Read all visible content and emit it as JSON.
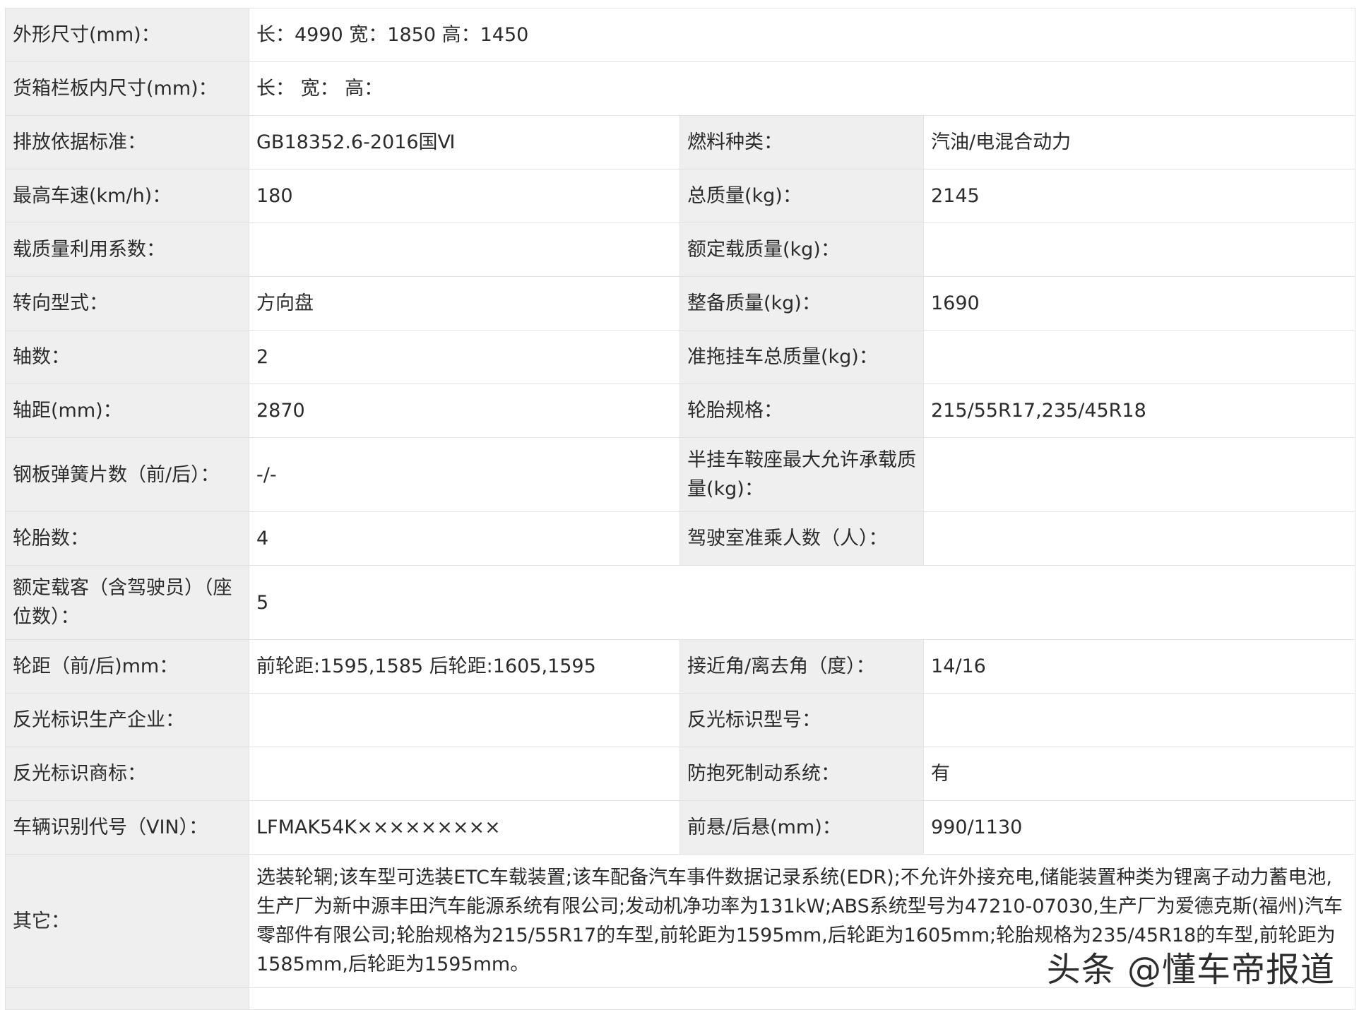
{
  "rows": [
    {
      "l1": "外形尺寸(mm)：",
      "v1": "长：4990 宽：1850 高：1450"
    },
    {
      "l1": "货箱栏板内尺寸(mm)：",
      "v1": "长：  宽：  高："
    },
    {
      "l1": "排放依据标准：",
      "v1": "GB18352.6-2016国Ⅵ",
      "l2": "燃料种类：",
      "v2": "汽油/电混合动力"
    },
    {
      "l1": "最高车速(km/h)：",
      "v1": "180",
      "l2": "总质量(kg)：",
      "v2": "2145"
    },
    {
      "l1": "载质量利用系数：",
      "v1": "",
      "l2": "额定载质量(kg)：",
      "v2": ""
    },
    {
      "l1": "转向型式：",
      "v1": "方向盘",
      "l2": "整备质量(kg)：",
      "v2": "1690"
    },
    {
      "l1": "轴数：",
      "v1": "2",
      "l2": "准拖挂车总质量(kg)：",
      "v2": ""
    },
    {
      "l1": "轴距(mm)：",
      "v1": "2870",
      "l2": "轮胎规格：",
      "v2": "215/55R17,235/45R18"
    },
    {
      "l1": "钢板弹簧片数（前/后）：",
      "v1": "-/-",
      "l2": "半挂车鞍座最大允许承载质量(kg)：",
      "v2": ""
    },
    {
      "l1": "轮胎数：",
      "v1": "4",
      "l2": "驾驶室准乘人数（人）：",
      "v2": ""
    },
    {
      "l1": "额定载客（含驾驶员）（座位数）：",
      "v1": "5"
    },
    {
      "l1": "轮距（前/后)mm：",
      "v1": "前轮距:1595,1585 后轮距:1605,1595",
      "l2": "接近角/离去角（度）：",
      "v2": "14/16"
    },
    {
      "l1": "反光标识生产企业：",
      "v1": "",
      "l2": "反光标识型号：",
      "v2": ""
    },
    {
      "l1": "反光标识商标：",
      "v1": "",
      "l2": "防抱死制动系统：",
      "v2": "有"
    },
    {
      "l1": "车辆识别代号（VIN）：",
      "v1": "LFMAK54K×××××××××",
      "l2": "前悬/后悬(mm)：",
      "v2": "990/1130"
    },
    {
      "l1": "其它：",
      "v1": "选装轮辋;该车型可选装ETC车载装置;该车配备汽车事件数据记录系统(EDR);不允许外接充电,储能装置种类为锂离子动力蓄电池,生产厂为新中源丰田汽车能源系统有限公司;发动机净功率为131kW;ABS系统型号为47210-07030,生产厂为爱德克斯(福州)汽车零部件有限公司;轮胎规格为215/55R17的车型,前轮距为1595mm,后轮距为1605mm;轮胎规格为235/45R18的车型,前轮距为1585mm,后轮距为1595mm。"
    }
  ],
  "watermark": "头条 @懂车帝报道"
}
